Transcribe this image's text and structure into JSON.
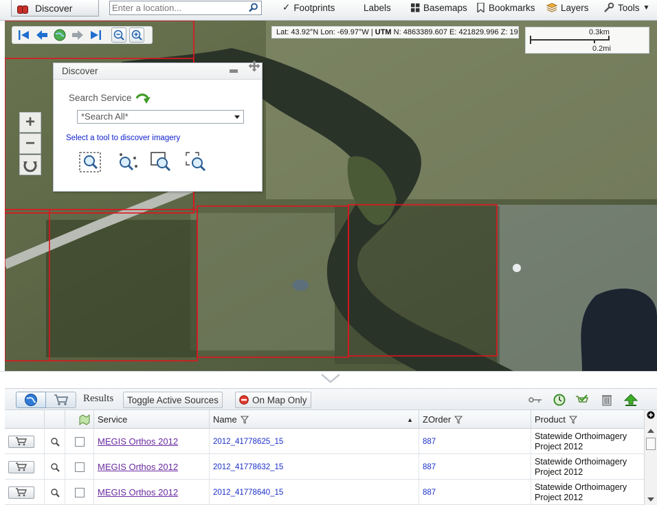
{
  "topbar": {
    "discover_label": "Discover",
    "location_placeholder": "Enter a location...",
    "footprints_label": "Footprints",
    "labels_label": "Labels",
    "basemaps_label": "Basemaps",
    "bookmarks_label": "Bookmarks",
    "layers_label": "Layers",
    "tools_label": "Tools"
  },
  "map": {
    "coords": {
      "latlon": "Lat: 43.92°N Lon: -69.97°W",
      "sep": "|",
      "utm_label": "UTM",
      "utm_value": "N: 4863389.607 E: 421829.996 Z: 19"
    },
    "scale": {
      "km": "0.3km",
      "mi": "0.2mi"
    },
    "zoom_in": "+",
    "zoom_out": "−"
  },
  "discover_panel": {
    "title": "Discover",
    "search_service_label": "Search Service",
    "search_select_value": "*Search All*",
    "hint": "Select a tool to discover imagery"
  },
  "results": {
    "title": "Results",
    "toggle_label": "Toggle Active Sources",
    "onmap_label": "On Map Only",
    "columns": [
      "Service",
      "Name",
      "ZOrder",
      "Product"
    ],
    "rows": [
      {
        "service": "MEGIS Orthos 2012",
        "name": "2012_41778625_15",
        "zorder": "887",
        "product": "Statewide Orthoimagery Project 2012"
      },
      {
        "service": "MEGIS Orthos 2012",
        "name": "2012_41778632_15",
        "zorder": "887",
        "product": "Statewide Orthoimagery Project 2012"
      },
      {
        "service": "MEGIS Orthos 2012",
        "name": "2012_41778640_15",
        "zorder": "887",
        "product": "Statewide Orthoimagery Project 2012"
      }
    ]
  },
  "colors": {
    "footprint_red": "#e0141e",
    "link_blue": "#1a2fc8",
    "visited_purple": "#6a2aa0"
  }
}
